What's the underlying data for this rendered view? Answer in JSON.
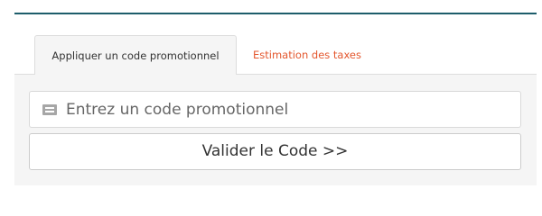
{
  "tabs": {
    "promo": {
      "label": "Appliquer un code promotionnel",
      "active": true
    },
    "taxes": {
      "label": "Estimation des taxes",
      "active": false
    }
  },
  "promo_form": {
    "icon": "ticket-icon",
    "value": "",
    "placeholder": "Entrez un code promotionnel",
    "submit_label": "Valider le Code >>"
  },
  "colors": {
    "top_rule": "#1d5d6b",
    "inactive_tab_text": "#e4572e",
    "panel_background": "#f5f5f5"
  }
}
